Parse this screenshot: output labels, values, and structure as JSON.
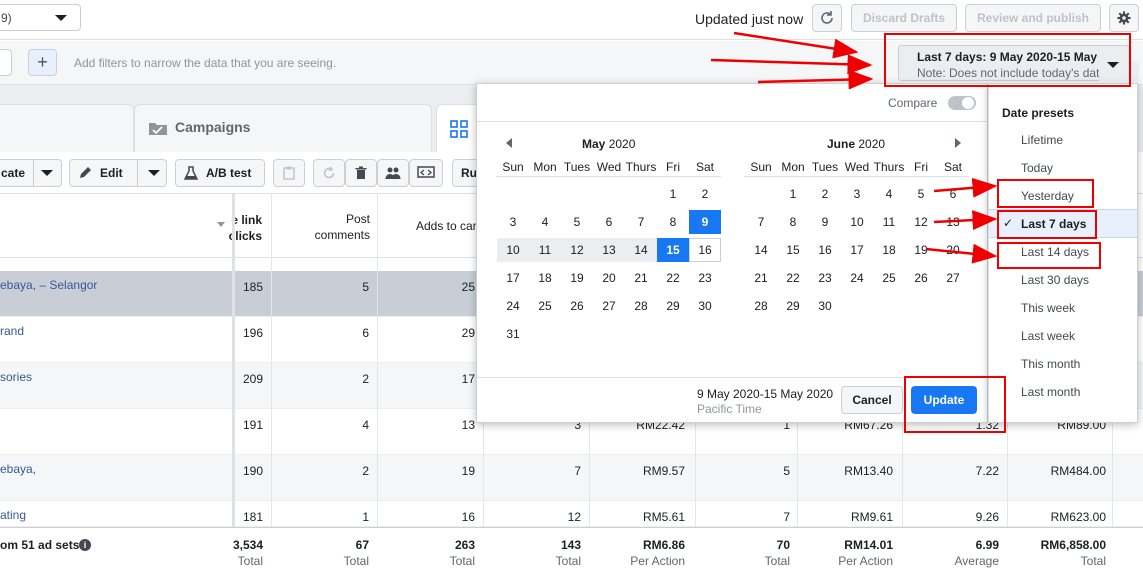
{
  "topbar": {
    "account_fragment": "9)",
    "updated_text": "Updated just now",
    "discard_label": "Discard Drafts",
    "review_label": "Review and publish"
  },
  "filterbar": {
    "placeholder": "Add filters to narrow the data that you are seeing."
  },
  "tabs": {
    "campaigns_label": "Campaigns"
  },
  "toolbar": {
    "duplicate_fragment": "cate",
    "edit_label": "Edit",
    "abtest_label": "A/B test",
    "rules_fragment": "Ru"
  },
  "table": {
    "headers": {
      "link_clicks": "e link\nclicks",
      "post_comments": "Post\ncomments",
      "adds_to_cart": "Adds to cart"
    },
    "rows": [
      {
        "name": "ebaya, – Selangor",
        "clicks": "185",
        "comments": "5",
        "adds": "25",
        "c4": "",
        "c5": "",
        "c6": "",
        "c7": "",
        "c8": "",
        "c9": ""
      },
      {
        "name": "rand",
        "clicks": "196",
        "comments": "6",
        "adds": "29",
        "c4": "",
        "c5": "",
        "c6": "",
        "c7": "",
        "c8": "",
        "c9": ""
      },
      {
        "name": "sories",
        "clicks": "209",
        "comments": "2",
        "adds": "17",
        "c4": "",
        "c5": "",
        "c6": "",
        "c7": "",
        "c8": "",
        "c9": ""
      },
      {
        "name": "",
        "clicks": "191",
        "comments": "4",
        "adds": "13",
        "c4": "3",
        "c5": "RM22.42",
        "c6": "1",
        "c7": "RM67.26",
        "c8": "1.32",
        "c9": "RM89.00"
      },
      {
        "name": "ebaya,",
        "clicks": "190",
        "comments": "2",
        "adds": "19",
        "c4": "7",
        "c5": "RM9.57",
        "c6": "5",
        "c7": "RM13.40",
        "c8": "7.22",
        "c9": "RM484.00"
      },
      {
        "name": "ating",
        "clicks": "181",
        "comments": "1",
        "adds": "16",
        "c4": "12",
        "c5": "RM5.61",
        "c6": "7",
        "c7": "RM9.61",
        "c8": "9.26",
        "c9": "RM623.00"
      }
    ],
    "totals": {
      "label": "om 51 ad sets",
      "clicks": "3,534",
      "clicks_sub": "Total",
      "comments": "67",
      "comments_sub": "Total",
      "adds": "263",
      "adds_sub": "Total",
      "c4": "143",
      "c4_sub": "Total",
      "c5": "RM6.86",
      "c5_sub": "Per Action",
      "c6": "70",
      "c6_sub": "Total",
      "c7": "RM14.01",
      "c7_sub": "Per Action",
      "c8": "6.99",
      "c8_sub": "Average",
      "c9": "RM6,858.00",
      "c9_sub": "Total"
    }
  },
  "date_range_button": {
    "title": "Last 7 days: 9 May 2020-15 May",
    "note": "Note: Does not include today's dat"
  },
  "picker": {
    "compare_label": "Compare",
    "dow": [
      "Sun",
      "Mon",
      "Tues",
      "Wed",
      "Thurs",
      "Fri",
      "Sat"
    ],
    "may": {
      "month": "May",
      "year": "2020",
      "weeks": [
        [
          "",
          "",
          "",
          "",
          "",
          "1",
          "2"
        ],
        [
          "3",
          "4",
          "5",
          "6",
          "7",
          "8",
          "9"
        ],
        [
          "10",
          "11",
          "12",
          "13",
          "14",
          "15",
          "16"
        ],
        [
          "17",
          "18",
          "19",
          "20",
          "21",
          "22",
          "23"
        ],
        [
          "24",
          "25",
          "26",
          "27",
          "28",
          "29",
          "30"
        ],
        [
          "31",
          "",
          "",
          "",
          "",
          "",
          ""
        ]
      ]
    },
    "june": {
      "month": "June",
      "year": "2020",
      "weeks": [
        [
          "",
          "1",
          "2",
          "3",
          "4",
          "5",
          "6"
        ],
        [
          "7",
          "8",
          "9",
          "10",
          "11",
          "12",
          "13"
        ],
        [
          "14",
          "15",
          "16",
          "17",
          "18",
          "19",
          "20"
        ],
        [
          "21",
          "22",
          "23",
          "24",
          "25",
          "26",
          "27"
        ],
        [
          "28",
          "29",
          "30",
          "",
          "",
          "",
          ""
        ]
      ]
    },
    "range_text": "9 May 2020-15 May 2020",
    "timezone": "Pacific Time",
    "cancel_label": "Cancel",
    "update_label": "Update"
  },
  "presets": {
    "heading": "Date presets",
    "items": [
      "Lifetime",
      "Today",
      "Yesterday",
      "Last 7 days",
      "Last 14 days",
      "Last 30 days",
      "This week",
      "Last week",
      "This month",
      "Last month"
    ],
    "checkmark": "✓"
  },
  "colors": {
    "accent": "#1877f2",
    "annotation_red": "#e00000",
    "range_fill": "#ebedf0"
  }
}
